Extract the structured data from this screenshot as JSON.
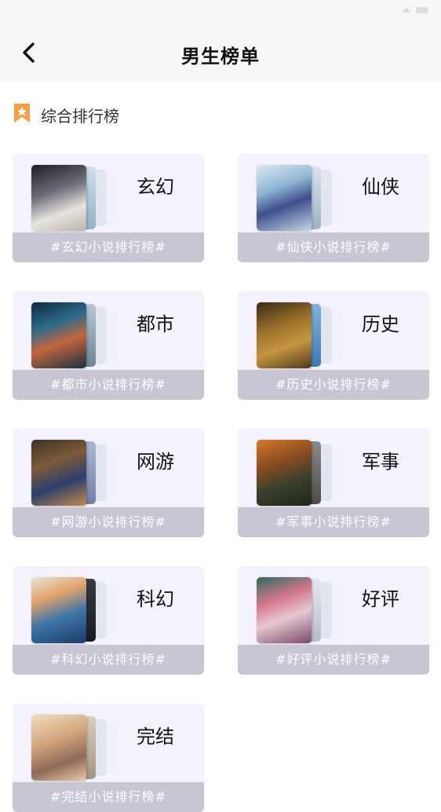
{
  "header": {
    "title": "男生榜单"
  },
  "section": {
    "title": "综合排行榜"
  },
  "colors": {
    "accent": "#f5a046",
    "card_bg": "#f4f3fd",
    "tag_bg": "#c8c6d2"
  },
  "cards": [
    {
      "name": "玄幻",
      "tag": "#玄幻小说排行榜#"
    },
    {
      "name": "仙侠",
      "tag": "#仙侠小说排行榜#"
    },
    {
      "name": "都市",
      "tag": "#都市小说排行榜#"
    },
    {
      "name": "历史",
      "tag": "#历史小说排行榜#"
    },
    {
      "name": "网游",
      "tag": "#网游小说排行榜#"
    },
    {
      "name": "军事",
      "tag": "#军事小说排行榜#"
    },
    {
      "name": "科幻",
      "tag": "#科幻小说排行榜#"
    },
    {
      "name": "好评",
      "tag": "#好评小说排行榜#"
    },
    {
      "name": "完结",
      "tag": "#完结小说排行榜#"
    }
  ]
}
